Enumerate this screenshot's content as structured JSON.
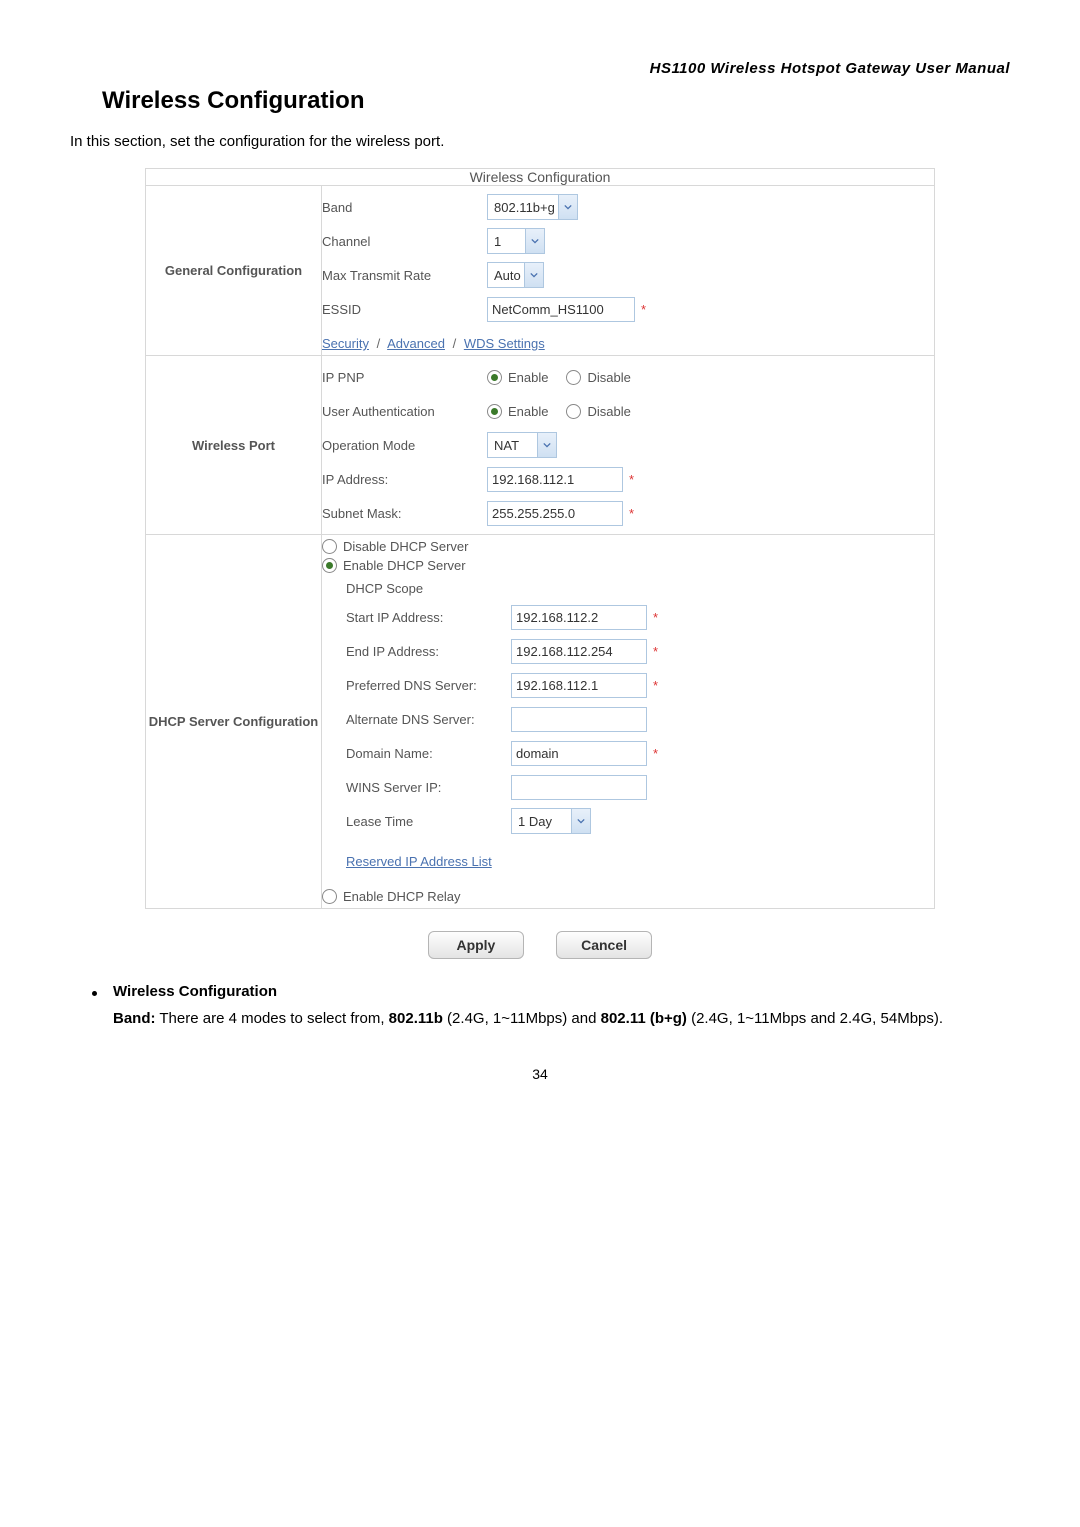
{
  "header": {
    "manual_title": "HS1100 Wireless Hotspot Gateway User Manual"
  },
  "page": {
    "title": "Wireless Configuration",
    "intro": "In this section, set the configuration for the wireless port.",
    "number": "34"
  },
  "table": {
    "caption": "Wireless Configuration",
    "general": {
      "section": "General Configuration",
      "band_label": "Band",
      "band_value": "802.11b+g",
      "channel_label": "Channel",
      "channel_value": "1",
      "rate_label": "Max Transmit Rate",
      "rate_value": "Auto",
      "essid_label": "ESSID",
      "essid_value": "NetComm_HS1100",
      "link_security": "Security",
      "link_advanced": "Advanced",
      "link_wds": "WDS Settings",
      "link_sep": "/"
    },
    "wport": {
      "section": "Wireless Port",
      "ippnp_label": "IP PNP",
      "userauth_label": "User Authentication",
      "opmode_label": "Operation Mode",
      "opmode_value": "NAT",
      "ipaddr_label": "IP Address:",
      "ipaddr_value": "192.168.112.1",
      "subnet_label": "Subnet Mask:",
      "subnet_value": "255.255.255.0",
      "enable": "Enable",
      "disable": "Disable"
    },
    "dhcp": {
      "section": "DHCP Server Configuration",
      "opt_disable": "Disable DHCP Server",
      "opt_enable": "Enable DHCP Server",
      "scope_label": "DHCP Scope",
      "start_label": "Start IP Address:",
      "start_value": "192.168.112.2",
      "end_label": "End IP Address:",
      "end_value": "192.168.112.254",
      "pdns_label": "Preferred DNS Server:",
      "pdns_value": "192.168.112.1",
      "adns_label": "Alternate DNS Server:",
      "adns_value": "",
      "domain_label": "Domain Name:",
      "domain_value": "domain",
      "wins_label": "WINS Server IP:",
      "wins_value": "",
      "lease_label": "Lease Time",
      "lease_value": "1 Day",
      "reserved_link": "Reserved IP Address List",
      "opt_relay": "Enable DHCP Relay"
    }
  },
  "buttons": {
    "apply": "Apply",
    "cancel": "Cancel"
  },
  "desc": {
    "heading": "Wireless Configuration",
    "band_key": "Band:",
    "band_text_1": " There are 4 modes to select from, ",
    "band_b": "802.11b",
    "band_text_2": " (2.4G, 1~11Mbps) and ",
    "band_bg": "802.11 (b+g)",
    "band_text_3": " (2.4G, 1~11Mbps and 2.4G, 54Mbps)."
  },
  "req_mark": "*"
}
